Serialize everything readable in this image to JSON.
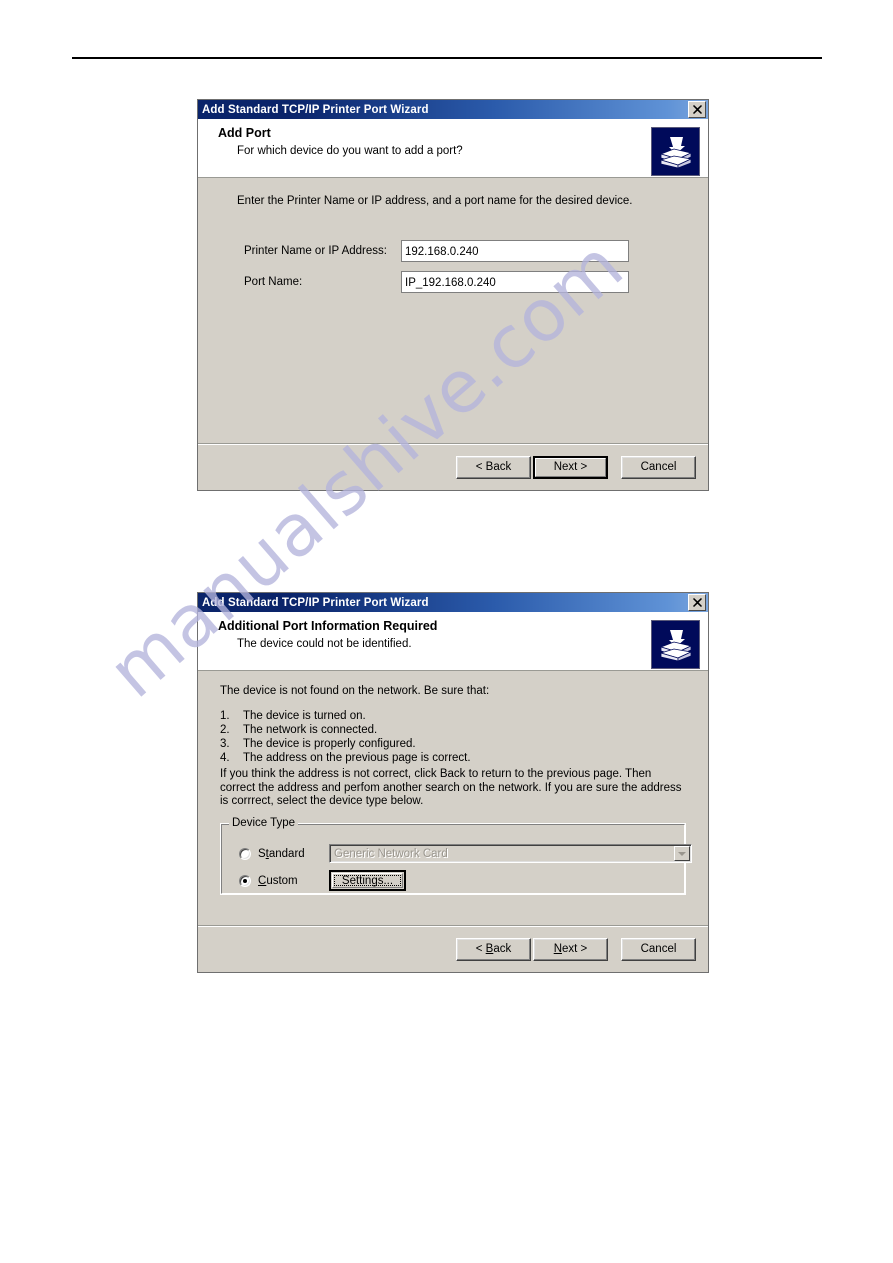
{
  "page": {
    "watermark": "manualshive.com",
    "watermark_color": "#b4b4dc",
    "rule_color": "#000000"
  },
  "common": {
    "window_title": "Add Standard TCP/IP Printer Port Wizard",
    "close_label": "✕",
    "printer_icon_name": "printer-icon",
    "icon_bg_color": "#000a5a",
    "titlebar_color_start": "#0a246a",
    "titlebar_color_end": "#7ba6de",
    "dialog_face_color": "#d4d0c8"
  },
  "dialog1": {
    "title": "Add Port",
    "subtitle": "For which device do you want to add a port?",
    "intro": "Enter the Printer Name or IP address, and a port name for the desired device.",
    "fields": [
      {
        "label": "Printer Name or IP Address:",
        "value": "192.168.0.240",
        "name": "printer-name-or-ip-input",
        "has_caret": true
      },
      {
        "label": "Port Name:",
        "value": "IP_192.168.0.240",
        "name": "port-name-input",
        "has_caret": false
      }
    ],
    "buttons": {
      "back": "< Back",
      "next": "Next >",
      "cancel": "Cancel",
      "default": "next"
    }
  },
  "dialog2": {
    "title": "Additional Port Information Required",
    "subtitle": "The device could not be identified.",
    "intro": "The device is not found on the network.  Be sure that:",
    "list": [
      {
        "num": "1.",
        "text": "The device is turned on."
      },
      {
        "num": "2.",
        "text": "The network is connected."
      },
      {
        "num": "3.",
        "text": "The device is properly configured."
      },
      {
        "num": "4.",
        "text": "The address on the previous page is correct."
      }
    ],
    "paragraph": "If you think the address is not correct, click Back to return to the previous page.  Then correct the address and perfom another search on the network.  If you are sure the address is corrrect, select the device type below.",
    "device_type": {
      "legend": "Device Type",
      "standard": {
        "label_pre": "S",
        "label_accel": "t",
        "label_post": "andard",
        "selected": false,
        "combo_value": "Generic Network Card",
        "combo_disabled": true
      },
      "custom": {
        "label_pre": "",
        "label_accel": "C",
        "label_post": "ustom",
        "selected": true,
        "settings_label": "Settings...",
        "settings_focused": true
      }
    },
    "buttons": {
      "back_pre": "< ",
      "back_accel": "B",
      "back_post": "ack",
      "next_pre": "",
      "next_accel": "N",
      "next_post": "ext >",
      "cancel": "Cancel",
      "default": "none"
    }
  }
}
